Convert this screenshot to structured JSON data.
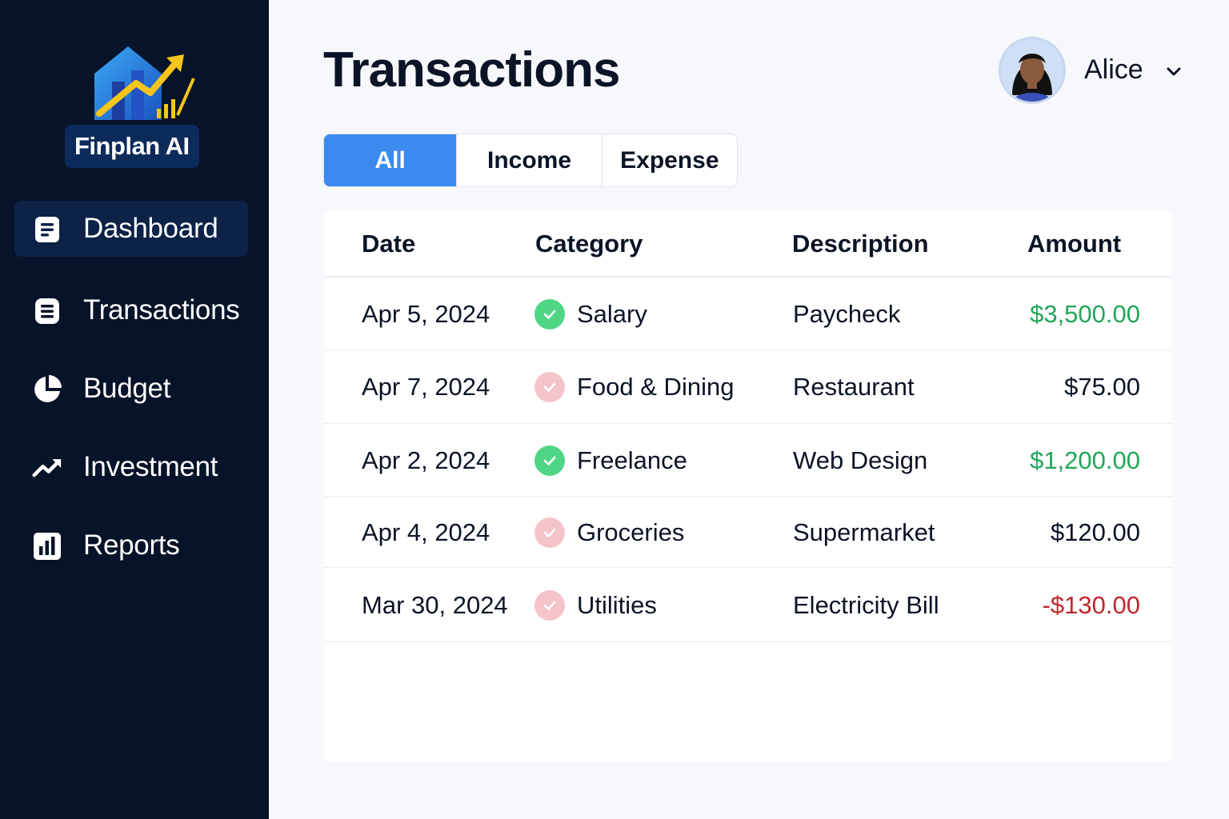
{
  "app": {
    "brand": "Finplan AI"
  },
  "sidebar": {
    "items": [
      {
        "label": "Dashboard",
        "icon": "document-icon",
        "active": true
      },
      {
        "label": "Transactions",
        "icon": "list-icon",
        "active": false
      },
      {
        "label": "Budget",
        "icon": "pie-chart-icon",
        "active": false
      },
      {
        "label": "Investment",
        "icon": "trend-up-icon",
        "active": false
      },
      {
        "label": "Reports",
        "icon": "bar-chart-icon",
        "active": false
      }
    ]
  },
  "header": {
    "title": "Transactions",
    "user_name": "Alice"
  },
  "tabs": [
    {
      "label": "All",
      "active": true
    },
    {
      "label": "Income",
      "active": false
    },
    {
      "label": "Expense",
      "active": false
    }
  ],
  "table": {
    "columns": [
      "Date",
      "Category",
      "Description",
      "Amount"
    ],
    "rows": [
      {
        "date": "Apr 5, 2024",
        "category": "Salary",
        "description": "Paycheck",
        "amount": "$3,500.00",
        "type": "income"
      },
      {
        "date": "Apr 7, 2024",
        "category": "Food & Dining",
        "description": "Restaurant",
        "amount": "$75.00",
        "type": "expense"
      },
      {
        "date": "Apr 2, 2024",
        "category": "Freelance",
        "description": "Web Design",
        "amount": "$1,200.00",
        "type": "income"
      },
      {
        "date": "Apr 4, 2024",
        "category": "Groceries",
        "description": "Supermarket",
        "amount": "$120.00",
        "type": "expense"
      },
      {
        "date": "Mar 30, 2024",
        "category": "Utilities",
        "description": "Electricity Bill",
        "amount": "-$130.00",
        "type": "negative"
      }
    ]
  },
  "colors": {
    "sidebar_bg": "#061328",
    "accent": "#3a8af0",
    "income": "#22a65a",
    "negative": "#c0272d",
    "expense": "#0b1426",
    "income_icon": "#4fd684",
    "expense_icon": "#f5c4cb"
  }
}
